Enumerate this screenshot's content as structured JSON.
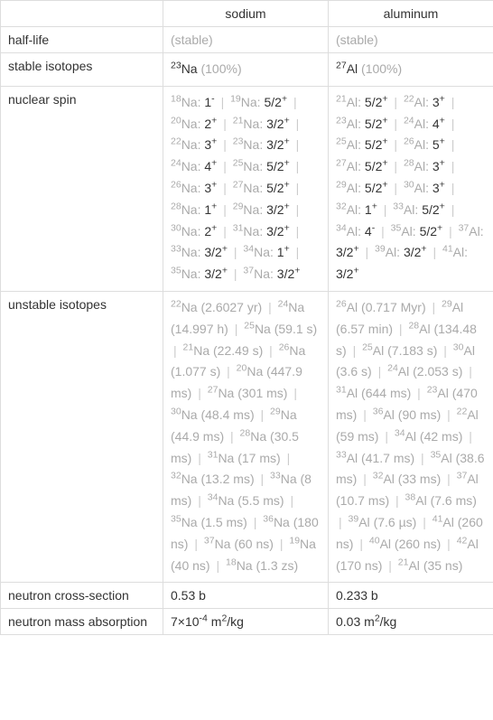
{
  "headers": {
    "sodium": "sodium",
    "aluminum": "aluminum"
  },
  "rows": {
    "half_life": {
      "label": "half-life",
      "sodium": "(stable)",
      "aluminum": "(stable)"
    },
    "stable_isotopes": {
      "label": "stable isotopes",
      "sodium": {
        "sup": "23",
        "el": "Na",
        "pct": "(100%)"
      },
      "aluminum": {
        "sup": "27",
        "el": "Al",
        "pct": "(100%)"
      }
    },
    "nuclear_spin": {
      "label": "nuclear spin",
      "sodium": [
        {
          "sup": "18",
          "el": "Na",
          "spin": "1",
          "sign": "-"
        },
        {
          "sup": "19",
          "el": "Na",
          "spin": "5/2",
          "sign": "+"
        },
        {
          "sup": "20",
          "el": "Na",
          "spin": "2",
          "sign": "+"
        },
        {
          "sup": "21",
          "el": "Na",
          "spin": "3/2",
          "sign": "+"
        },
        {
          "sup": "22",
          "el": "Na",
          "spin": "3",
          "sign": "+"
        },
        {
          "sup": "23",
          "el": "Na",
          "spin": "3/2",
          "sign": "+"
        },
        {
          "sup": "24",
          "el": "Na",
          "spin": "4",
          "sign": "+"
        },
        {
          "sup": "25",
          "el": "Na",
          "spin": "5/2",
          "sign": "+"
        },
        {
          "sup": "26",
          "el": "Na",
          "spin": "3",
          "sign": "+"
        },
        {
          "sup": "27",
          "el": "Na",
          "spin": "5/2",
          "sign": "+"
        },
        {
          "sup": "28",
          "el": "Na",
          "spin": "1",
          "sign": "+"
        },
        {
          "sup": "29",
          "el": "Na",
          "spin": "3/2",
          "sign": "+"
        },
        {
          "sup": "30",
          "el": "Na",
          "spin": "2",
          "sign": "+"
        },
        {
          "sup": "31",
          "el": "Na",
          "spin": "3/2",
          "sign": "+"
        },
        {
          "sup": "33",
          "el": "Na",
          "spin": "3/2",
          "sign": "+"
        },
        {
          "sup": "34",
          "el": "Na",
          "spin": "1",
          "sign": "+"
        },
        {
          "sup": "35",
          "el": "Na",
          "spin": "3/2",
          "sign": "+"
        },
        {
          "sup": "37",
          "el": "Na",
          "spin": "3/2",
          "sign": "+"
        }
      ],
      "aluminum": [
        {
          "sup": "21",
          "el": "Al",
          "spin": "5/2",
          "sign": "+"
        },
        {
          "sup": "22",
          "el": "Al",
          "spin": "3",
          "sign": "+"
        },
        {
          "sup": "23",
          "el": "Al",
          "spin": "5/2",
          "sign": "+"
        },
        {
          "sup": "24",
          "el": "Al",
          "spin": "4",
          "sign": "+"
        },
        {
          "sup": "25",
          "el": "Al",
          "spin": "5/2",
          "sign": "+"
        },
        {
          "sup": "26",
          "el": "Al",
          "spin": "5",
          "sign": "+"
        },
        {
          "sup": "27",
          "el": "Al",
          "spin": "5/2",
          "sign": "+"
        },
        {
          "sup": "28",
          "el": "Al",
          "spin": "3",
          "sign": "+"
        },
        {
          "sup": "29",
          "el": "Al",
          "spin": "5/2",
          "sign": "+"
        },
        {
          "sup": "30",
          "el": "Al",
          "spin": "3",
          "sign": "+"
        },
        {
          "sup": "32",
          "el": "Al",
          "spin": "1",
          "sign": "+"
        },
        {
          "sup": "33",
          "el": "Al",
          "spin": "5/2",
          "sign": "+"
        },
        {
          "sup": "34",
          "el": "Al",
          "spin": "4",
          "sign": "-"
        },
        {
          "sup": "35",
          "el": "Al",
          "spin": "5/2",
          "sign": "+"
        },
        {
          "sup": "37",
          "el": "Al",
          "spin": "3/2",
          "sign": "+"
        },
        {
          "sup": "39",
          "el": "Al",
          "spin": "3/2",
          "sign": "+"
        },
        {
          "sup": "41",
          "el": "Al",
          "spin": "3/2",
          "sign": "+"
        }
      ]
    },
    "unstable_isotopes": {
      "label": "unstable isotopes",
      "sodium": [
        {
          "sup": "22",
          "el": "Na",
          "t": "(2.6027 yr)"
        },
        {
          "sup": "24",
          "el": "Na",
          "t": "(14.997 h)"
        },
        {
          "sup": "25",
          "el": "Na",
          "t": "(59.1 s)"
        },
        {
          "sup": "21",
          "el": "Na",
          "t": "(22.49 s)"
        },
        {
          "sup": "26",
          "el": "Na",
          "t": "(1.077 s)"
        },
        {
          "sup": "20",
          "el": "Na",
          "t": "(447.9 ms)"
        },
        {
          "sup": "27",
          "el": "Na",
          "t": "(301 ms)"
        },
        {
          "sup": "30",
          "el": "Na",
          "t": "(48.4 ms)"
        },
        {
          "sup": "29",
          "el": "Na",
          "t": "(44.9 ms)"
        },
        {
          "sup": "28",
          "el": "Na",
          "t": "(30.5 ms)"
        },
        {
          "sup": "31",
          "el": "Na",
          "t": "(17 ms)"
        },
        {
          "sup": "32",
          "el": "Na",
          "t": "(13.2 ms)"
        },
        {
          "sup": "33",
          "el": "Na",
          "t": "(8 ms)"
        },
        {
          "sup": "34",
          "el": "Na",
          "t": "(5.5 ms)"
        },
        {
          "sup": "35",
          "el": "Na",
          "t": "(1.5 ms)"
        },
        {
          "sup": "36",
          "el": "Na",
          "t": "(180 ns)"
        },
        {
          "sup": "37",
          "el": "Na",
          "t": "(60 ns)"
        },
        {
          "sup": "19",
          "el": "Na",
          "t": "(40 ns)"
        },
        {
          "sup": "18",
          "el": "Na",
          "t": "(1.3 zs)"
        }
      ],
      "aluminum": [
        {
          "sup": "26",
          "el": "Al",
          "t": "(0.717 Myr)"
        },
        {
          "sup": "29",
          "el": "Al",
          "t": "(6.57 min)"
        },
        {
          "sup": "28",
          "el": "Al",
          "t": "(134.48 s)"
        },
        {
          "sup": "25",
          "el": "Al",
          "t": "(7.183 s)"
        },
        {
          "sup": "30",
          "el": "Al",
          "t": "(3.6 s)"
        },
        {
          "sup": "24",
          "el": "Al",
          "t": "(2.053 s)"
        },
        {
          "sup": "31",
          "el": "Al",
          "t": "(644 ms)"
        },
        {
          "sup": "23",
          "el": "Al",
          "t": "(470 ms)"
        },
        {
          "sup": "36",
          "el": "Al",
          "t": "(90 ms)"
        },
        {
          "sup": "22",
          "el": "Al",
          "t": "(59 ms)"
        },
        {
          "sup": "34",
          "el": "Al",
          "t": "(42 ms)"
        },
        {
          "sup": "33",
          "el": "Al",
          "t": "(41.7 ms)"
        },
        {
          "sup": "35",
          "el": "Al",
          "t": "(38.6 ms)"
        },
        {
          "sup": "32",
          "el": "Al",
          "t": "(33 ms)"
        },
        {
          "sup": "37",
          "el": "Al",
          "t": "(10.7 ms)"
        },
        {
          "sup": "38",
          "el": "Al",
          "t": "(7.6 ms)"
        },
        {
          "sup": "39",
          "el": "Al",
          "t": "(7.6 µs)"
        },
        {
          "sup": "41",
          "el": "Al",
          "t": "(260 ns)"
        },
        {
          "sup": "40",
          "el": "Al",
          "t": "(260 ns)"
        },
        {
          "sup": "42",
          "el": "Al",
          "t": "(170 ns)"
        },
        {
          "sup": "21",
          "el": "Al",
          "t": "(35 ns)"
        }
      ]
    },
    "neutron_cross_section": {
      "label": "neutron cross-section",
      "sodium": "0.53 b",
      "aluminum": "0.233 b"
    },
    "neutron_mass_absorption": {
      "label": "neutron mass absorption",
      "sodium": {
        "coef": "7×10",
        "exp": "-4",
        "unit": " m",
        "usup": "2",
        "rest": "/kg"
      },
      "aluminum": {
        "coef": "0.03 m",
        "exp": "",
        "unit": "",
        "usup": "2",
        "rest": "/kg"
      }
    }
  }
}
